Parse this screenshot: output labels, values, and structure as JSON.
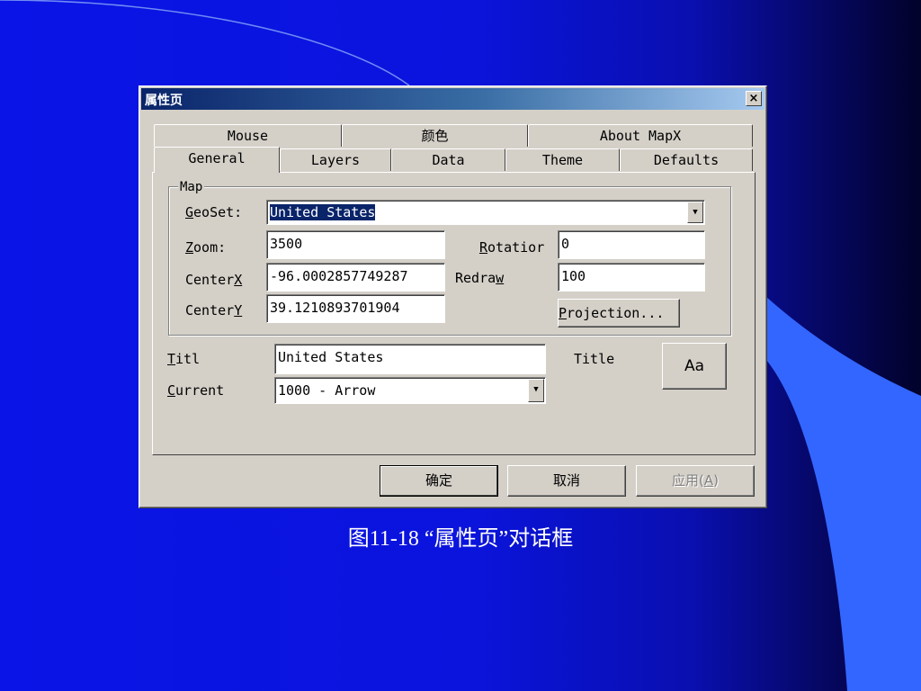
{
  "dialog": {
    "title": "属性页",
    "close_label": "×"
  },
  "tabs_row_back": [
    {
      "label": "Mouse"
    },
    {
      "label": "颜色"
    },
    {
      "label": "About MapX"
    }
  ],
  "tabs_row_front": [
    {
      "label": "General",
      "active": true
    },
    {
      "label": "Layers"
    },
    {
      "label": "Data"
    },
    {
      "label": "Theme"
    },
    {
      "label": "Defaults"
    }
  ],
  "map_group": {
    "legend": "Map",
    "geoset_label_u": "G",
    "geoset_label_rest": "eoSet:",
    "geoset_value": "United States",
    "zoom_label_u": "Z",
    "zoom_label_rest": "oom:",
    "zoom_value": "3500",
    "rotation_label_u": "R",
    "rotation_label_rest": "otatior",
    "rotation_value": "0",
    "centerx_label": "Center",
    "centerx_label_u": "X",
    "centerx_value": "-96.0002857749287",
    "redraw_label": "Redra",
    "redraw_label_u": "w",
    "redraw_value": "100",
    "centery_label": "Center",
    "centery_label_u": "Y",
    "centery_value": "39.1210893701904",
    "projection_label_u": "P",
    "projection_label_rest": "rojection..."
  },
  "title_section": {
    "titl_label_u": "T",
    "titl_label_rest": "itl",
    "titl_value": "United States",
    "title_label": "Title",
    "font_button_label": "Aa",
    "current_label_u": "C",
    "current_label_rest": "urrent",
    "current_value": "1000 - Arrow"
  },
  "buttons": {
    "ok": "确定",
    "cancel": "取消",
    "apply": "应用(",
    "apply_u": "A",
    "apply_end": ")"
  },
  "caption": "图11-18 “属性页”对话框",
  "colors": {
    "background": "#0a14e6",
    "accent_shape": "#3366ff",
    "dialog_face": "#d4d0c8",
    "titlebar_start": "#0a246a"
  }
}
